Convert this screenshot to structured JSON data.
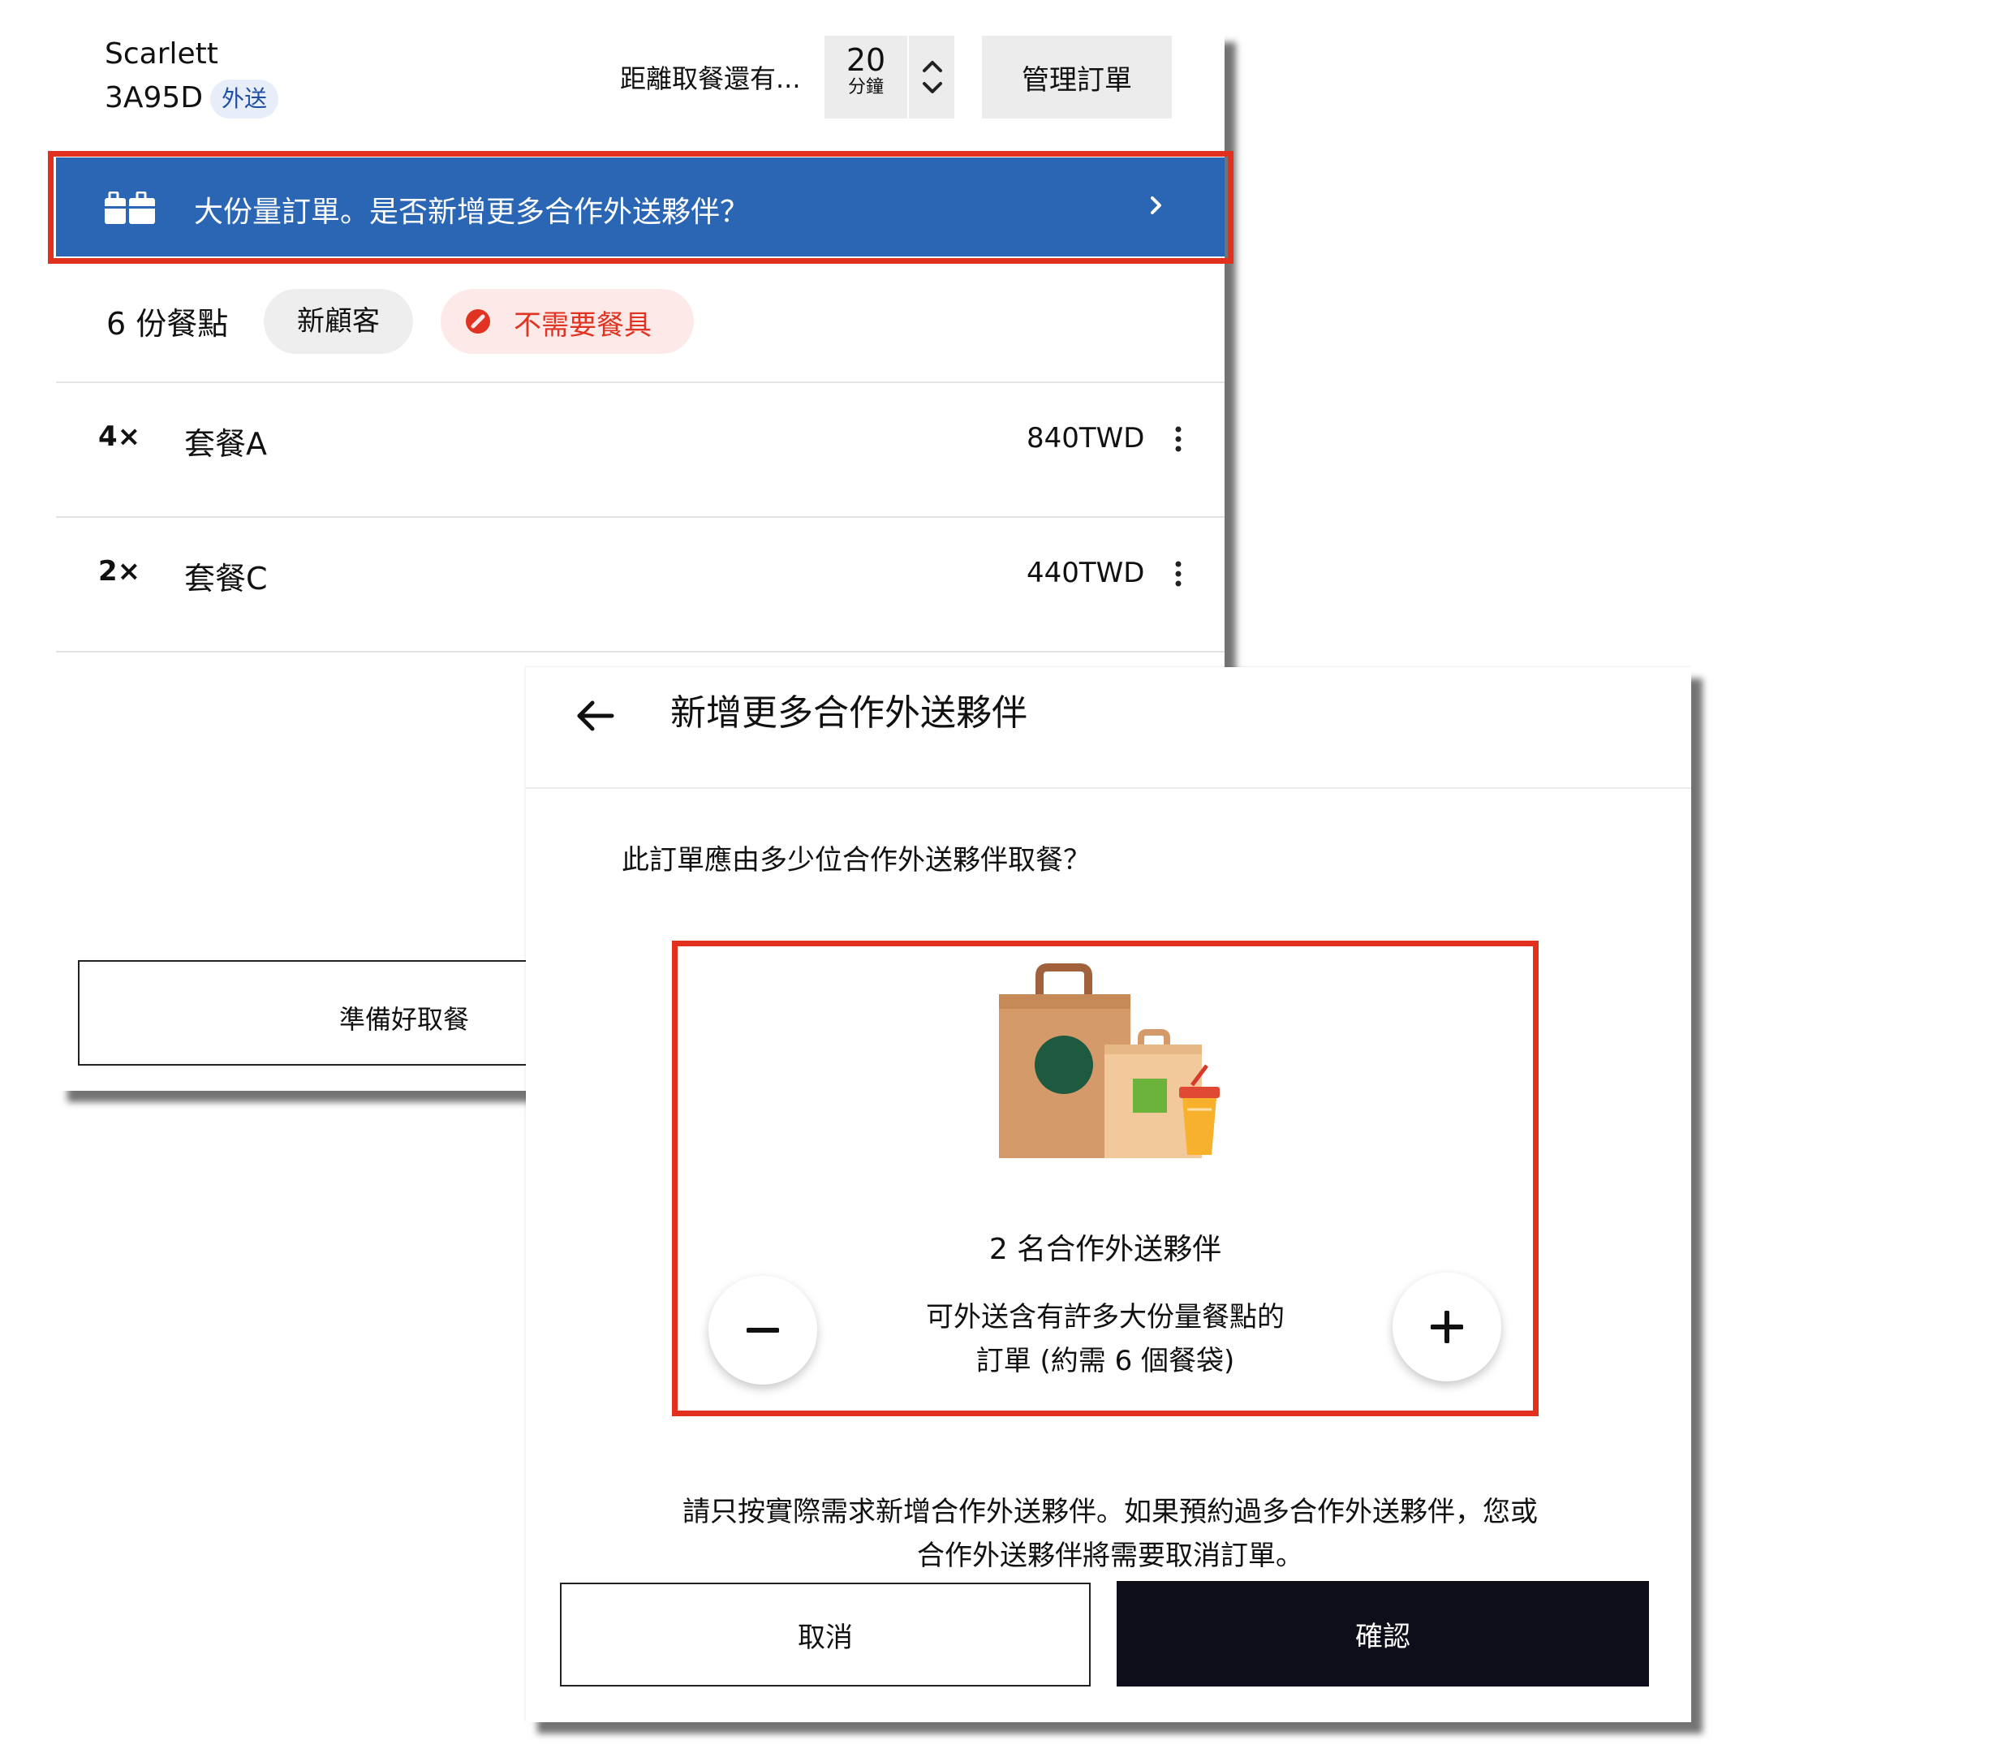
{
  "order": {
    "customer_name": "Scarlett",
    "order_code": "3A95D",
    "delivery_badge": "外送",
    "pickup_time_label": "距離取餐還有...",
    "pickup_minutes": "20",
    "pickup_minutes_unit": "分鐘",
    "manage_button": "管理訂單",
    "banner_text": "大份量訂單。是否新增更多合作外送夥伴？",
    "meal_count": "6 份餐點",
    "tags": {
      "new_customer": "新顧客",
      "no_utensils": "不需要餐具"
    },
    "items": [
      {
        "qty": "4×",
        "name": "套餐A",
        "price": "840TWD"
      },
      {
        "qty": "2×",
        "name": "套餐C",
        "price": "440TWD"
      }
    ],
    "ready_button": "準備好取餐"
  },
  "dialog": {
    "title": "新增更多合作外送夥伴",
    "question": "此訂單應由多少位合作外送夥伴取餐？",
    "courier_count_label": "2 名合作外送夥伴",
    "courier_description_line1": "可外送含有許多大份量餐點的",
    "courier_description_line2": "訂單 (約需 6 個餐袋)",
    "warning_line1": "請只按實際需求新增合作外送夥伴。如果預約過多合作外送夥伴，您或",
    "warning_line2": "合作外送夥伴將需要取消訂單。",
    "cancel_button": "取消",
    "confirm_button": "確認"
  },
  "colors": {
    "banner_blue": "#2a66b3",
    "highlight_red": "#e1301e",
    "no_utensils_red": "#e03322",
    "confirm_dark": "#0e0e1a"
  },
  "icons": {
    "banner": "shopping-bags-icon",
    "stepper": "chevron-up-down-icon",
    "item_menu": "more-vertical-icon",
    "back": "arrow-left-icon",
    "decrement": "minus-icon",
    "increment": "plus-icon"
  }
}
